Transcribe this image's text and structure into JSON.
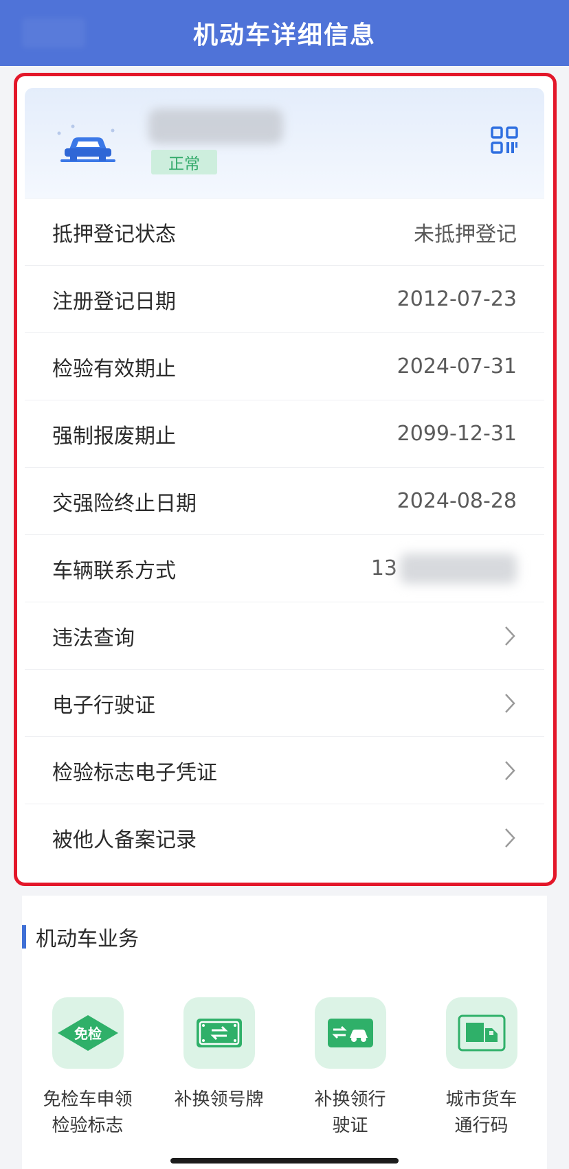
{
  "header": {
    "title": "机动车详细信息"
  },
  "vehicle": {
    "status": "正常",
    "car_icon": "car-icon",
    "qr_icon": "qr-code-icon"
  },
  "info_rows": [
    {
      "label": "抵押登记状态",
      "value": "未抵押登记"
    },
    {
      "label": "注册登记日期",
      "value": "2012-07-23"
    },
    {
      "label": "检验有效期止",
      "value": "2024-07-31"
    },
    {
      "label": "强制报废期止",
      "value": "2099-12-31"
    },
    {
      "label": "交强险终止日期",
      "value": "2024-08-28"
    },
    {
      "label": "车辆联系方式",
      "value": "13"
    }
  ],
  "link_rows": [
    {
      "label": "违法查询"
    },
    {
      "label": "电子行驶证"
    },
    {
      "label": "检验标志电子凭证"
    },
    {
      "label": "被他人备案记录"
    }
  ],
  "business": {
    "title": "机动车业务",
    "tiles": [
      {
        "line1": "免检车申领",
        "line2": "检验标志",
        "badge": "免检",
        "icon": "exempt-inspection-icon"
      },
      {
        "line1": "补换领号牌",
        "line2": "",
        "icon": "license-plate-swap-icon"
      },
      {
        "line1": "补换领行",
        "line2": "驶证",
        "icon": "driving-license-swap-icon"
      },
      {
        "line1": "城市货车",
        "line2": "通行码",
        "icon": "truck-pass-icon"
      }
    ]
  },
  "colors": {
    "header": "#4f73d8",
    "highlight_border": "#e3172a",
    "status_green": "#2ea867",
    "icon_green": "#33b36e",
    "accent_blue": "#3f6fd6"
  }
}
